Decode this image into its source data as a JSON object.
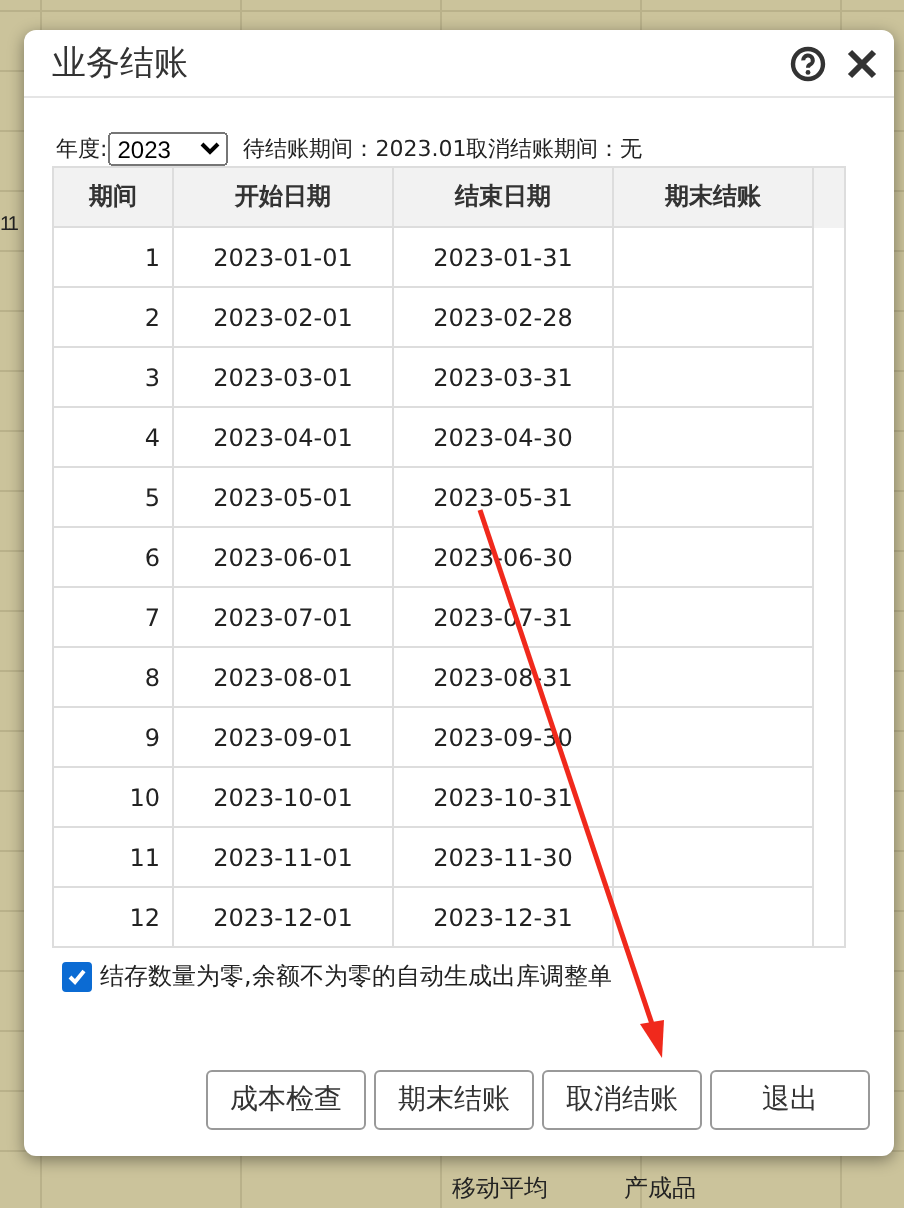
{
  "background": {
    "row_number": "11",
    "cells": [
      "移动平均",
      "产成品"
    ]
  },
  "dialog": {
    "title": "业务结账",
    "year_label": "年度:",
    "year": "2023",
    "status": "待结账期间：2023.01取消结账期间：无",
    "columns": [
      "期间",
      "开始日期",
      "结束日期",
      "期末结账"
    ],
    "rows": [
      {
        "period": "1",
        "start": "2023-01-01",
        "end": "2023-01-31"
      },
      {
        "period": "2",
        "start": "2023-02-01",
        "end": "2023-02-28"
      },
      {
        "period": "3",
        "start": "2023-03-01",
        "end": "2023-03-31"
      },
      {
        "period": "4",
        "start": "2023-04-01",
        "end": "2023-04-30"
      },
      {
        "period": "5",
        "start": "2023-05-01",
        "end": "2023-05-31"
      },
      {
        "period": "6",
        "start": "2023-06-01",
        "end": "2023-06-30"
      },
      {
        "period": "7",
        "start": "2023-07-01",
        "end": "2023-07-31"
      },
      {
        "period": "8",
        "start": "2023-08-01",
        "end": "2023-08-31"
      },
      {
        "period": "9",
        "start": "2023-09-01",
        "end": "2023-09-30"
      },
      {
        "period": "10",
        "start": "2023-10-01",
        "end": "2023-10-31"
      },
      {
        "period": "11",
        "start": "2023-11-01",
        "end": "2023-11-30"
      },
      {
        "period": "12",
        "start": "2023-12-01",
        "end": "2023-12-31"
      }
    ],
    "auto_adjust": {
      "label": "结存数量为零,余额不为零的自动生成出库调整单",
      "checked": true
    },
    "buttons": [
      "成本检查",
      "期末结账",
      "取消结账",
      "退出"
    ]
  }
}
